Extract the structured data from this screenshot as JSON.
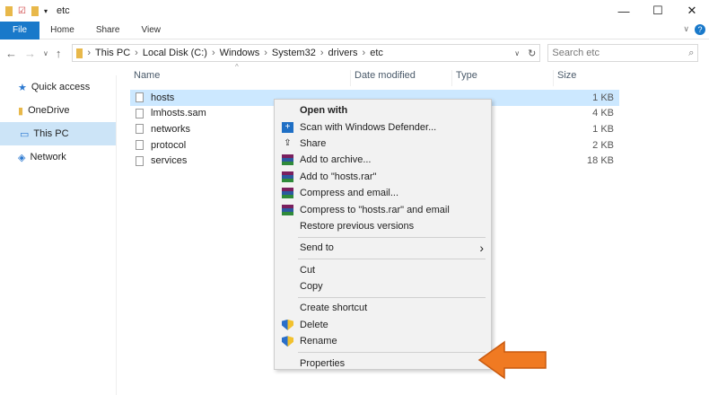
{
  "window": {
    "title": "etc",
    "minimize": "—",
    "maximize": "☐",
    "close": "✕"
  },
  "ribbon": {
    "tabs": [
      "File",
      "Home",
      "Share",
      "View"
    ],
    "help": "?",
    "expand": "∨"
  },
  "address": {
    "back": "←",
    "forward": "→",
    "recent": "∨",
    "up": "↑",
    "crumbs": [
      "This PC",
      "Local Disk (C:)",
      "Windows",
      "System32",
      "drivers",
      "etc"
    ],
    "sep": "›",
    "dropdown": "∨",
    "refresh": "↻",
    "search_placeholder": "Search etc",
    "search_icon": "⌕"
  },
  "sidebar": {
    "items": [
      {
        "label": "Quick access",
        "icon": "★"
      },
      {
        "label": "OneDrive",
        "icon": "▮"
      },
      {
        "label": "This PC",
        "icon": "▭"
      },
      {
        "label": "Network",
        "icon": "◈"
      }
    ]
  },
  "columns": {
    "name": "Name",
    "date": "Date modified",
    "type": "Type",
    "size": "Size",
    "sort": "^"
  },
  "files": [
    {
      "name": "hosts",
      "size": "1 KB"
    },
    {
      "name": "lmhosts.sam",
      "size": "4 KB"
    },
    {
      "name": "networks",
      "size": "1 KB"
    },
    {
      "name": "protocol",
      "size": "2 KB"
    },
    {
      "name": "services",
      "size": "18 KB"
    }
  ],
  "menu": {
    "open_with": "Open with",
    "scan": "Scan with Windows Defender...",
    "share": "Share",
    "add_archive": "Add to archive...",
    "add_rar": "Add to \"hosts.rar\"",
    "compress_email": "Compress and email...",
    "compress_rar_email": "Compress to \"hosts.rar\" and email",
    "restore": "Restore previous versions",
    "send_to": "Send to",
    "send_arrow": "›",
    "cut": "Cut",
    "copy": "Copy",
    "create_shortcut": "Create shortcut",
    "delete": "Delete",
    "rename": "Rename",
    "properties": "Properties"
  },
  "colors": {
    "accent": "#1979ca",
    "selection": "#cce8ff",
    "arrow": "#f07a22"
  }
}
